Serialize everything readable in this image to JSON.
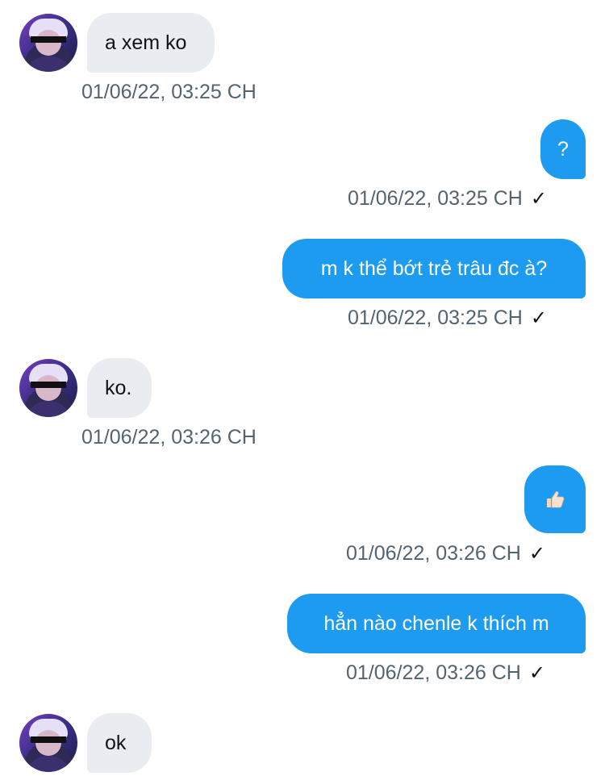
{
  "messages": [
    {
      "direction": "in",
      "text": "a xem ko",
      "time": "01/06/22, 03:25 CH"
    },
    {
      "direction": "out",
      "text": "?",
      "time": "01/06/22, 03:25 CH",
      "status_icon": "check-icon"
    },
    {
      "direction": "out",
      "text": "m k thể bớt trẻ trâu đc à?",
      "time": "01/06/22, 03:25 CH",
      "status_icon": "check-icon"
    },
    {
      "direction": "in",
      "text": "ko.",
      "time": "01/06/22, 03:26 CH"
    },
    {
      "direction": "out",
      "emoji": "thumbs-up-icon",
      "time": "01/06/22, 03:26 CH",
      "status_icon": "check-icon"
    },
    {
      "direction": "out",
      "text": "hẳn nào chenle k thích m",
      "time": "01/06/22, 03:26 CH",
      "status_icon": "check-icon"
    },
    {
      "direction": "in",
      "text": "ok"
    }
  ],
  "check_glyph": "✓",
  "colors": {
    "incoming_bubble": "#e9edf1",
    "outgoing_bubble": "#1d9bf0",
    "timestamp": "#536471"
  }
}
